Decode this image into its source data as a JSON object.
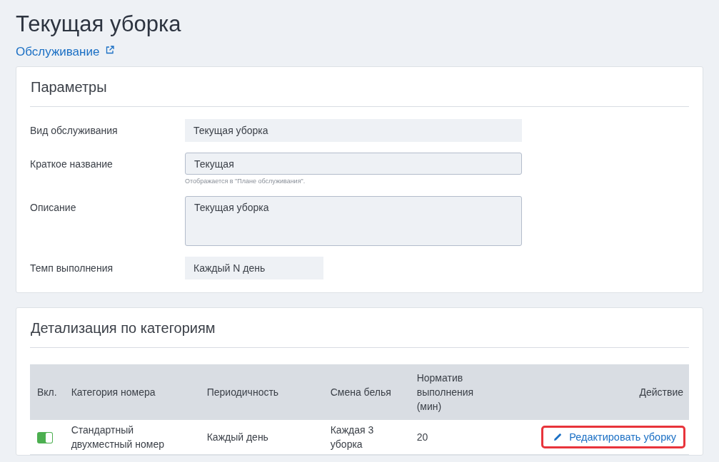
{
  "page": {
    "title": "Текущая уборка",
    "link": "Обслуживание"
  },
  "parameters": {
    "title": "Параметры",
    "fields": [
      {
        "kind": "static",
        "label": "Вид обслуживания",
        "value": "Текущая уборка"
      },
      {
        "kind": "input",
        "label": "Краткое название",
        "value": "Текущая",
        "hint": "Отображается в \"Плане обслуживания\"."
      },
      {
        "kind": "textarea",
        "label": "Описание",
        "value": "Текущая уборка"
      },
      {
        "kind": "short",
        "label": "Темп выполнения",
        "value": "Каждый N день"
      }
    ]
  },
  "categories": {
    "title": "Детализация по категориям",
    "table": {
      "columns": [
        "Вкл.",
        "Категория номера",
        "Периодичность",
        "Смена белья",
        "Норматив выполнения (мин)",
        "Действие"
      ],
      "rows": [
        {
          "enabled": true,
          "category": "Стандартный двухместный номер",
          "frequency": "Каждый день",
          "linen_change": "Каждая 3 уборка",
          "norm": "20",
          "action": {
            "label": "Редактировать уборку",
            "highlighted": true
          }
        }
      ]
    }
  }
}
